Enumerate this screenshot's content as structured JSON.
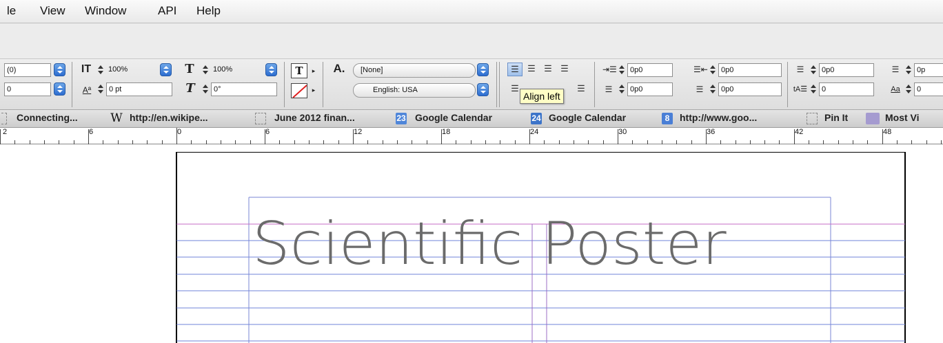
{
  "menu": [
    "le",
    "View",
    "Window",
    "API",
    "Help"
  ],
  "control_panel": {
    "font_field": "(0)",
    "size_field": "0",
    "vertical_scale": "100%",
    "horizontal_scale": "100%",
    "baseline_shift": "0 pt",
    "skew": "0°",
    "char_style": "[None]",
    "language": "English: USA",
    "left_indent": "0p0",
    "first_line_indent": "0p0",
    "right_indent": "0p0",
    "last_line_indent": "0p0",
    "space_before": "0p0",
    "space_after": "0p0",
    "space_before_partial": "0p",
    "drop_cap_lines": "0",
    "drop_cap_chars": "0"
  },
  "tooltip": "Align left",
  "bookmarks": [
    {
      "label": "Connecting...",
      "icon": "dashed-box-icon"
    },
    {
      "label": "http://en.wikipe...",
      "icon": "wikipedia-icon"
    },
    {
      "label": "June 2012 finan...",
      "icon": "dashed-box-icon"
    },
    {
      "label": "Google Calendar",
      "icon": "calendar-23-icon"
    },
    {
      "label": "Google Calendar",
      "icon": "calendar-24-icon"
    },
    {
      "label": "http://www.goo...",
      "icon": "google-icon"
    },
    {
      "label": "Pin It",
      "icon": "dashed-box-icon"
    },
    {
      "label": "Most Vi",
      "icon": "folder-icon"
    }
  ],
  "ruler": [
    "2",
    "6",
    "0",
    "6",
    "12",
    "18",
    "24",
    "30",
    "36",
    "42",
    "48"
  ],
  "document": {
    "title": "Scientific Poster"
  },
  "colors": {
    "guide_blue": "#6f83d8",
    "margin_magenta": "#c66bc4",
    "title_gray": "#6b6b6b",
    "tooltip_bg": "#fffec6"
  }
}
